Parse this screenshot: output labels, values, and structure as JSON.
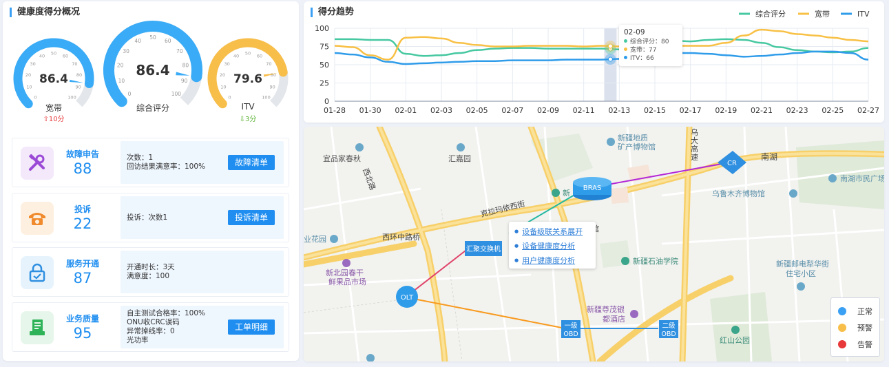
{
  "overview": {
    "title": "健康度得分概况",
    "gauges": [
      {
        "label": "宽带",
        "score": "86.4",
        "value": 86.4,
        "delta": "10分",
        "delta_dir": "up",
        "color": "#3aabf6"
      },
      {
        "label": "综合评分",
        "score": "86.4",
        "value": 86.4,
        "color": "#3aabf6"
      },
      {
        "label": "ITV",
        "score": "79.6",
        "value": 79.6,
        "delta": "3分",
        "delta_dir": "down",
        "color": "#f8be4a"
      }
    ],
    "tick_labels": [
      "0",
      "10",
      "20",
      "30",
      "40",
      "50",
      "60",
      "70",
      "80",
      "90",
      "100"
    ]
  },
  "cards": [
    {
      "title": "故障申告",
      "count": "88",
      "lines": [
        "次数：1",
        "回访结果满意率：100%"
      ],
      "button": "故障清单",
      "icon": "tools-icon"
    },
    {
      "title": "投诉",
      "count": "22",
      "lines": [
        "投诉：次数1"
      ],
      "button": "投诉清单",
      "icon": "phone-icon"
    },
    {
      "title": "服务开通",
      "count": "87",
      "lines": [
        "开通时长：3天",
        "满意度：100"
      ],
      "button": null,
      "icon": "lock-icon"
    },
    {
      "title": "业务质量",
      "count": "95",
      "lines": [
        "自主测试合格率：100%",
        "ONU收CRC误码",
        "异常掉线率：0",
        "光功率"
      ],
      "button": "工单明细",
      "icon": "document-icon"
    }
  ],
  "trend": {
    "title": "得分趋势",
    "tooltip": {
      "date": "02-09",
      "rows": [
        "综合评分：80",
        "宽带：77",
        "ITV：66"
      ]
    }
  },
  "chart_data": {
    "type": "line",
    "title": "得分趋势",
    "ylim": [
      0,
      100
    ],
    "yticks": [
      "0",
      "25",
      "50",
      "75",
      "100"
    ],
    "xticks": [
      "01-28",
      "01-30",
      "02-01",
      "02-03",
      "02-05",
      "02-07",
      "02-09",
      "02-11",
      "02-13",
      "02-15",
      "02-17",
      "02-19",
      "02-21",
      "02-23",
      "02-25",
      "02-27"
    ],
    "legend_position": "top-right",
    "highlight_x": "02-12",
    "series": [
      {
        "name": "综合评分",
        "color": "#46c8a0",
        "values": [
          85,
          85,
          84,
          84,
          65,
          62,
          63,
          66,
          70,
          72,
          73,
          73,
          72,
          72,
          72,
          72,
          71,
          70,
          80,
          83,
          82,
          84,
          85,
          84,
          80,
          74,
          70,
          68,
          67,
          68,
          73
        ]
      },
      {
        "name": "宽带",
        "color": "#f8c044",
        "values": [
          76,
          74,
          63,
          57,
          87,
          88,
          86,
          80,
          77,
          75,
          75,
          76,
          76,
          76,
          75,
          76,
          75,
          75,
          77,
          76,
          76,
          76,
          80,
          90,
          98,
          96,
          92,
          90,
          87,
          84,
          82
        ]
      },
      {
        "name": "ITV",
        "color": "#2f9cea",
        "values": [
          66,
          64,
          60,
          54,
          51,
          52,
          53,
          54,
          55,
          55,
          56,
          56,
          56,
          57,
          57,
          57,
          58,
          59,
          63,
          66,
          66,
          65,
          63,
          61,
          62,
          64,
          66,
          68,
          68,
          66,
          57
        ]
      }
    ]
  },
  "map": {
    "labels": {
      "yipin": "宜品家春秋",
      "huijuyuan": "汇嘉园",
      "xinjiang_museum": "新疆地质\n矿产博物馆",
      "nanhu": "南湖",
      "nanhu_square": "南湖市民广场",
      "urumqi_museum": "乌鲁木齐博物馆",
      "kelamayi": "克拉玛依西街",
      "xihuan": "西环中路桥",
      "xibei_road": "西北路",
      "airport_road": "乌大高速",
      "huayuan": "业花园",
      "spring": "新北园春干\n鲜果品市场",
      "petro": "新疆石油学院",
      "post": "新疆邮电犁华街\n住宅小区",
      "hotel": "新疆尊茂银\n都酒店",
      "hongshan": "红山公园",
      "xin": "新",
      "guan": "馆"
    },
    "nodes": {
      "bras": "BRAS",
      "cr": "CR",
      "olt": "OLT",
      "switch": "汇聚交换机",
      "obd1": "一级\nOBD",
      "obd2": "二级\nOBD"
    },
    "menu": [
      "设备级联关系展开",
      "设备健康度分析",
      "用户健康度分析"
    ],
    "legend": [
      {
        "label": "正常",
        "color": "#3aa0f3"
      },
      {
        "label": "预警",
        "color": "#f8be4a"
      },
      {
        "label": "告警",
        "color": "#e8393a"
      }
    ]
  }
}
